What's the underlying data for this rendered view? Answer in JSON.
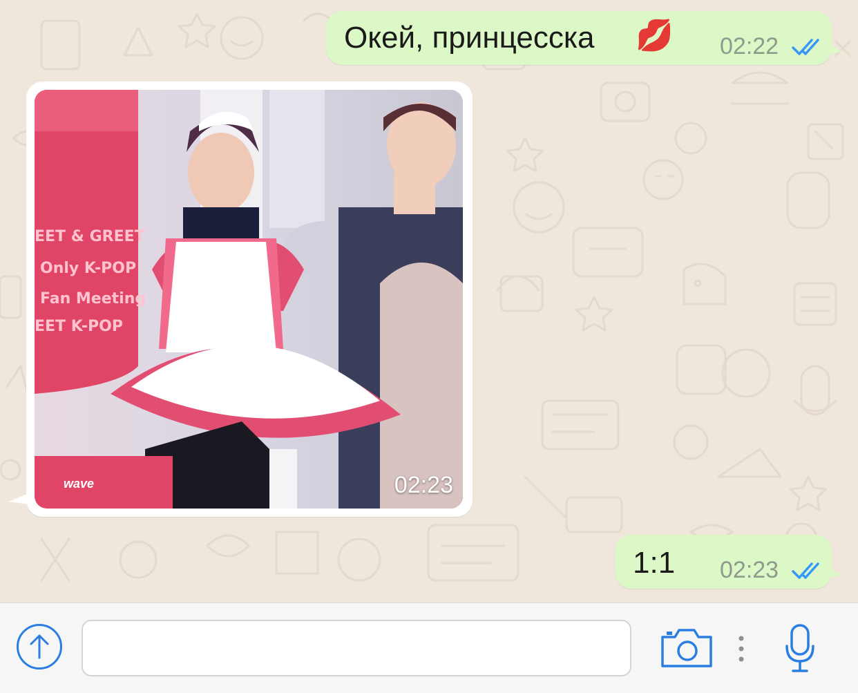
{
  "messages": [
    {
      "direction": "outgoing",
      "type": "text",
      "text": "Окей, принцесска",
      "emoji": "💋",
      "time": "02:22",
      "status": "read"
    },
    {
      "direction": "incoming",
      "type": "image",
      "time": "02:23",
      "image_text": {
        "sign_lines": [
          "EET & GREET",
          "Only K-POP",
          "Fan Meeting",
          "EET  K-POP"
        ],
        "brand": "wave"
      }
    },
    {
      "direction": "outgoing",
      "type": "text",
      "text": "1:1",
      "time": "02:23",
      "status": "read"
    }
  ],
  "input_bar": {
    "upload_icon": "arrow-up-circle-icon",
    "input_value": "",
    "camera_icon": "camera-icon",
    "more_icon": "vertical-dots-icon",
    "mic_icon": "microphone-icon"
  },
  "colors": {
    "outgoing_bubble": "#dcf8c6",
    "incoming_bubble": "#ffffff",
    "read_check": "#3497f9",
    "accent": "#2a7de1",
    "chat_background": "#efe7dc"
  }
}
